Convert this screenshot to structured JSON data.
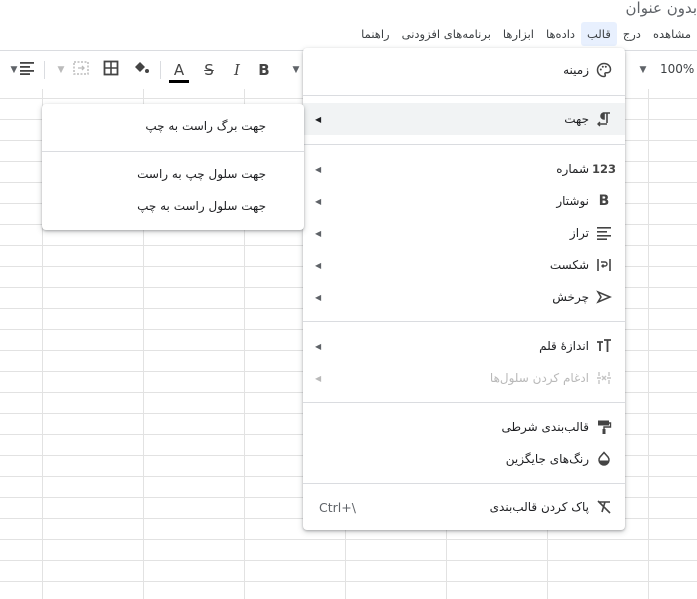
{
  "document": {
    "title": "بدون عنوان"
  },
  "menubar": {
    "items": [
      "مشاهده",
      "درج",
      "قالب",
      "داده‌ها",
      "ابزارها",
      "برنامه‌های افزودنی",
      "راهنما"
    ],
    "active": "قالب"
  },
  "toolbar": {
    "zoom": "100%"
  },
  "format_menu": {
    "items": [
      {
        "label": "زمینه",
        "icon": "palette-icon",
        "submenu": false
      },
      {
        "label": "جهت",
        "icon": "paragraph-direction-icon",
        "submenu": true
      },
      {
        "label": "شماره",
        "icon": "number-123-icon",
        "submenu": true
      },
      {
        "label": "نوشتار",
        "icon": "bold-icon",
        "submenu": true
      },
      {
        "label": "تراز",
        "icon": "align-icon",
        "submenu": true
      },
      {
        "label": "شکست",
        "icon": "wrap-icon",
        "submenu": true
      },
      {
        "label": "چرخش",
        "icon": "rotate-icon",
        "submenu": true
      },
      {
        "label": "اندازهٔ قلم",
        "icon": "font-size-icon",
        "submenu": true
      },
      {
        "label": "ادغام کردن سلول‌ها",
        "icon": "merge-icon",
        "submenu": true,
        "disabled": true
      },
      {
        "label": "قالب‌بندی شرطی",
        "icon": "paint-roller-icon",
        "submenu": false
      },
      {
        "label": "رنگ‌های جایگزین",
        "icon": "color-drop-icon",
        "submenu": false
      },
      {
        "label": "پاک کردن قالب‌بندی",
        "icon": "clear-format-icon",
        "submenu": false,
        "shortcut": "Ctrl+\\"
      }
    ]
  },
  "direction_submenu": {
    "items": [
      {
        "label": "جهت برگ راست به چپ"
      },
      {
        "label": "جهت سلول چپ به راست"
      },
      {
        "label": "جهت سلول راست به چپ"
      }
    ]
  }
}
